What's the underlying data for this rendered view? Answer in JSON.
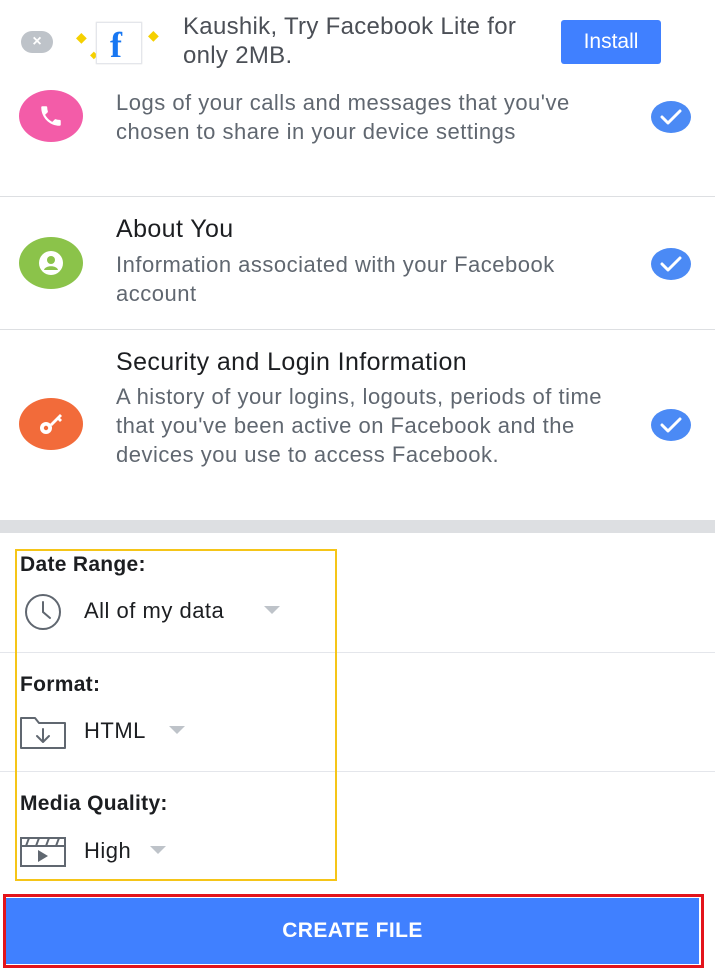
{
  "banner": {
    "message": "Kaushik, Try Facebook Lite for only 2MB.",
    "install_label": "Install",
    "logo_letter": "f",
    "close_glyph": "×",
    "spark_glyph": "◆"
  },
  "categories": [
    {
      "title": "",
      "description": "Logs of your calls and messages that you've chosen to share in your device settings",
      "icon": "phone-icon",
      "color": "#f35ca8",
      "checked": true
    },
    {
      "title": "About You",
      "description": "Information associated with your Facebook account",
      "icon": "person-icon",
      "color": "#8bc34a",
      "checked": true
    },
    {
      "title": "Security and Login Information",
      "description": "A history of your logins, logouts, periods of time that you've been active on Facebook and the devices you use to access Facebook.",
      "icon": "key-icon",
      "color": "#f26b3a",
      "checked": true
    }
  ],
  "options": {
    "date_range": {
      "label": "Date Range:",
      "value": "All of my data",
      "icon": "clock-icon"
    },
    "format": {
      "label": "Format:",
      "value": "HTML",
      "icon": "folder-download-icon"
    },
    "media_quality": {
      "label": "Media Quality:",
      "value": "High",
      "icon": "video-icon"
    }
  },
  "create_button_label": "CREATE FILE",
  "colors": {
    "accent": "#4080ff",
    "check": "#4b8af5",
    "highlight_yellow": "#f5c518",
    "highlight_red": "#e3141b"
  }
}
